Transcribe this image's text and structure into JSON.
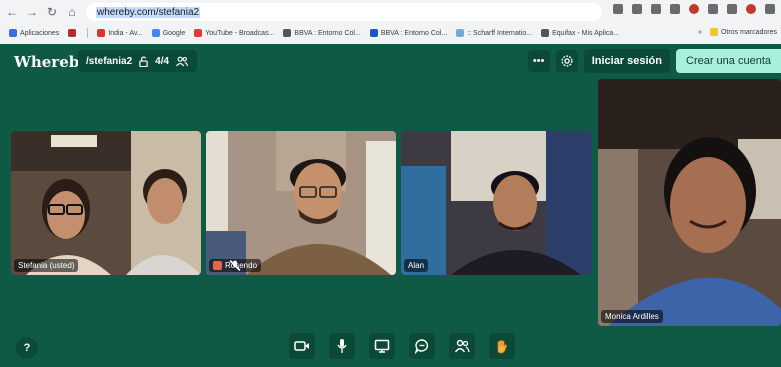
{
  "browser": {
    "url": "whereby.com/stefania2",
    "bookmarks": [
      {
        "label": "Aplicaciones",
        "color": "#3b6fd8"
      },
      {
        "label": "",
        "color": "#b32d2d"
      },
      {
        "label": "India - Av...",
        "color": "#d33"
      },
      {
        "label": "Google",
        "color": "#4285f4"
      },
      {
        "label": "YouTube - Broadcas...",
        "color": "#e53935"
      },
      {
        "label": "BBVA : Entorno Col...",
        "color": "#555555"
      },
      {
        "label": "BBVA : Entorno Col...",
        "color": "#1a56c4"
      },
      {
        "label": ":: Scharff Internatio...",
        "color": "#7aa7d8"
      },
      {
        "label": "Equifax - Mis Aplica...",
        "color": "#555555"
      }
    ],
    "bookmarks_overflow": "»",
    "other_bookmarks": "Otros marcadores"
  },
  "app": {
    "logo": "Whereby",
    "room": "/stefania2",
    "participant_count": "4/4",
    "signin_label": "Iniciar sesión",
    "create_label": "Crear una cuenta",
    "more_label": "•••"
  },
  "participants": [
    {
      "name": "Stefania (usted)",
      "muted": false
    },
    {
      "name": "Rosendo",
      "muted": true
    },
    {
      "name": "Alan",
      "muted": false
    },
    {
      "name": "Monica Ardilles",
      "muted": false
    }
  ],
  "help_label": "?",
  "colors": {
    "background": "#0e5a44",
    "button_bg": "#0b4a37",
    "create_button": "#a8f0dc",
    "muted_badge": "#e8654a"
  },
  "icons": {
    "camera": "camera-icon",
    "mic": "microphone-icon",
    "screen": "screen-share-icon",
    "chat": "chat-icon",
    "people": "people-icon",
    "reactions": "raise-hand-icon"
  }
}
